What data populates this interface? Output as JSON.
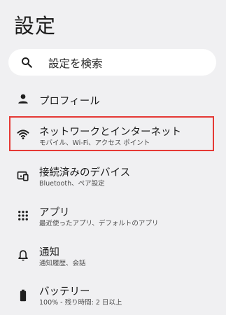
{
  "header": {
    "title": "設定"
  },
  "search": {
    "placeholder": "設定を検索",
    "icon": "search-icon"
  },
  "items": [
    {
      "title": "プロフィール",
      "subtitle": "",
      "icon": "person-icon"
    },
    {
      "title": "ネットワークとインターネット",
      "subtitle": "モバイル、Wi-Fi、アクセス ポイント",
      "icon": "wifi-icon"
    },
    {
      "title": "接続済みのデバイス",
      "subtitle": "Bluetooth、ペア設定",
      "icon": "devices-icon"
    },
    {
      "title": "アプリ",
      "subtitle": "最近使ったアプリ、デフォルトのアプリ",
      "icon": "apps-grid-icon"
    },
    {
      "title": "通知",
      "subtitle": "通知履歴、会話",
      "icon": "bell-icon"
    },
    {
      "title": "バッテリー",
      "subtitle": "100% - 残り時間: 2 日以上",
      "icon": "battery-icon"
    }
  ],
  "colors": {
    "background": "#f0f0f2",
    "highlight_border": "#e53935",
    "text": "#1b1b1b"
  }
}
